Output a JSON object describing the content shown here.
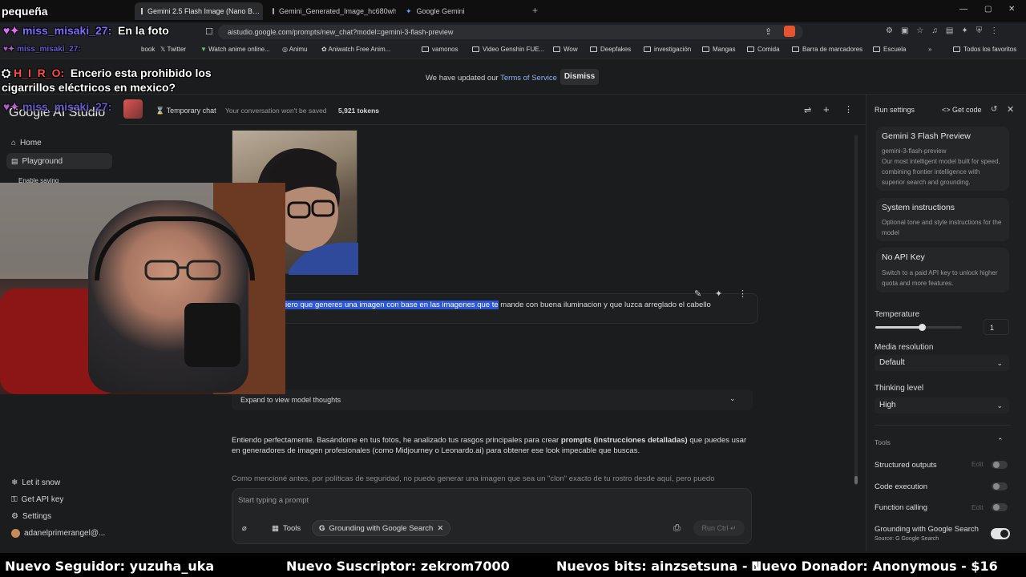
{
  "browser": {
    "tabs": [
      {
        "label": "Gemini 2.5 Flash Image (Nano B…",
        "active": true
      },
      {
        "label": "Gemini_Generated_Image_hc680wh…",
        "active": false
      },
      {
        "label": "Google Gemini",
        "active": false
      }
    ],
    "url": "aistudio.google.com/prompts/new_chat?model=gemini-3-flash-preview",
    "bookmarks": [
      "book",
      "Twitter",
      "Watch anime online...",
      "Animu",
      "Aniwatch Free Anim...",
      "vamonos",
      "Video Genshin FUE...",
      "Wow",
      "Deepfakes",
      "investigación",
      "Mangas",
      "Comida",
      "Barra de marcadores",
      "Escuela",
      "Todos los favoritos"
    ]
  },
  "notice": {
    "text": "We have updated our",
    "link": "Terms of Service",
    "dismiss": "Dismiss"
  },
  "sidebar": {
    "logo": "Google AI Studio",
    "home": "Home",
    "playground": "Playground",
    "enable_saving": "Enable saving",
    "let_it_snow": "Let it snow",
    "get_api_key": "Get API key",
    "settings": "Settings",
    "account": "adanelprimerangel@..."
  },
  "header": {
    "temporary": "Temporary chat",
    "not_saved": "Your conversation won't be saved",
    "tokens": "5,921 tokens"
  },
  "chat": {
    "prompt_highlighted": "iero que generes una imagen con base en las imagenes que te",
    "prompt_rest": " mande con buena iluminacion y que luzca arreglado el cabello",
    "thoughts": "Expand to view model thoughts",
    "answer_p1_before": "Entiendo perfectamente. Basándome en tus fotos, he analizado tus rasgos principales para crear ",
    "answer_p1_bold": "prompts (instrucciones detalladas)",
    "answer_p1_after": " que puedes usar en generadores de imagen profesionales (como Midjourney o Leonardo.ai) para obtener ese look impecable que buscas.",
    "answer_p2": "Como mencioné antes, por políticas de seguridad, no puedo generar una imagen que sea un \"clon\" exacto de tu rostro desde aquí, pero puedo"
  },
  "input": {
    "placeholder": "Start typing a prompt",
    "tools": "Tools",
    "grounding_chip": "Grounding with Google Search",
    "run": "Run Ctrl ↵"
  },
  "run_settings": {
    "title": "Run settings",
    "get_code": "Get code",
    "model_name": "Gemini 3 Flash Preview",
    "model_id": "gemini-3-flash-preview",
    "model_desc": "Our most intelligent model built for speed, combining frontier intelligence with superior search and grounding.",
    "sys_title": "System instructions",
    "sys_desc": "Optional tone and style instructions for the model",
    "api_title": "No API Key",
    "api_desc": "Switch to a paid API key to unlock higher quota and more features.",
    "temperature_label": "Temperature",
    "temperature_value": "1",
    "temperature_fraction": 0.27,
    "media_label": "Media resolution",
    "media_value": "Default",
    "thinking_label": "Thinking level",
    "thinking_value": "High",
    "tools_label": "Tools",
    "structured": "Structured outputs",
    "code_exec": "Code execution",
    "function_calling": "Function calling",
    "grounding": "Grounding with Google Search",
    "source": "Source:",
    "source_name": "Google Search",
    "edit": "Edit"
  },
  "stream_overlay": {
    "top_word": "pequeña",
    "chat1_name": "miss_misaki_27:",
    "chat1_msg": "En la foto",
    "chat2_name": "miss_misaki_27:",
    "chat3_name": "H_I_R_O:",
    "chat3_msg": "Encerio esta prohibido los cigarrillos eléctricos en mexico?",
    "chat4_name": "miss_misaki_27:",
    "follower": "Nuevo Seguidor: yuzuha_uka",
    "subscriber": "Nuevo Suscriptor: zekrom7000",
    "bits": "Nuevos bits: ainzsetsuna - 1",
    "donor": "Nuevo Donador: Anonymous - $16"
  },
  "colors": {
    "accent_link": "#8ab4f8",
    "highlight": "#2b57d8",
    "chat_name": "#7b6cff",
    "chat_name_red": "#ff4b4b"
  }
}
